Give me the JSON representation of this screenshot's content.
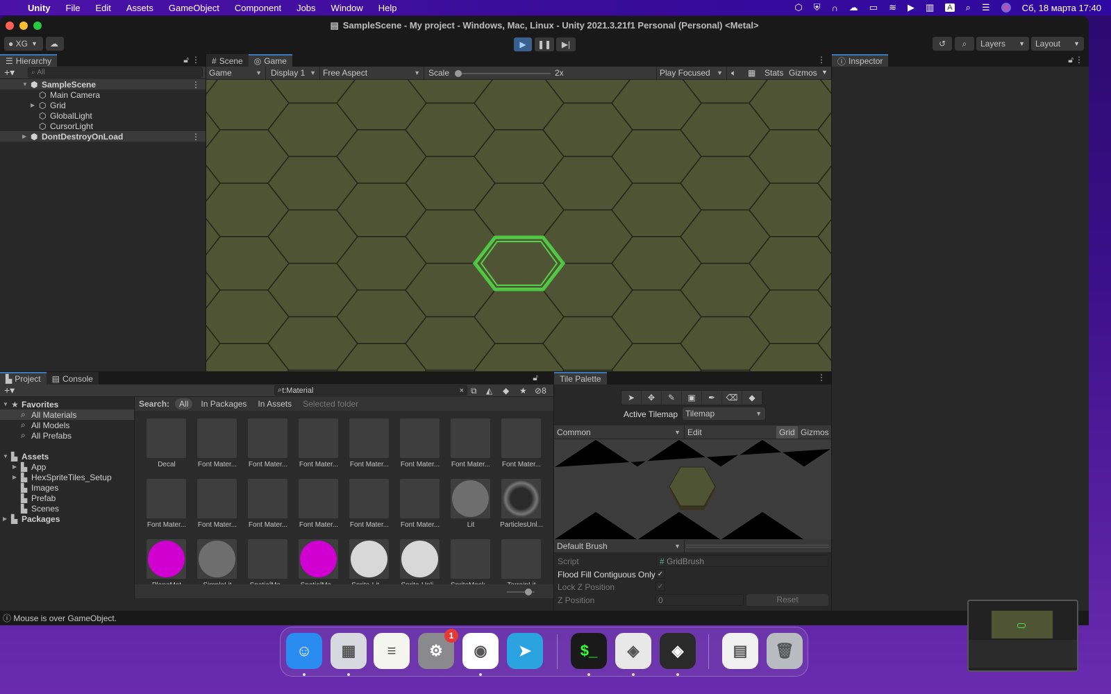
{
  "menubar": {
    "apple": "",
    "app": "Unity",
    "items": [
      "File",
      "Edit",
      "Assets",
      "GameObject",
      "Component",
      "Jobs",
      "Window",
      "Help"
    ],
    "status_icons": [
      "unity-icon",
      "vpn-icon",
      "headphones-icon",
      "cloud-icon",
      "battery-icon",
      "wifi-icon",
      "play-icon",
      "keyboard-icon",
      "input-source-icon",
      "search-icon",
      "control-center-icon",
      "siri-icon"
    ],
    "input_source": "A",
    "datetime": "Сб, 18 марта  17:40"
  },
  "window": {
    "title": "SampleScene - My project - Windows, Mac, Linux - Unity 2021.3.21f1 Personal (Personal) <Metal>"
  },
  "toolbar": {
    "account": "XG",
    "layers": "Layers",
    "layout": "Layout"
  },
  "hierarchy": {
    "tab": "Hierarchy",
    "search_placeholder": "All",
    "items": [
      {
        "label": "SampleScene",
        "level": 0,
        "type": "scene",
        "expanded": true,
        "selected": true
      },
      {
        "label": "Main Camera",
        "level": 1,
        "type": "object"
      },
      {
        "label": "Grid",
        "level": 1,
        "type": "object",
        "collapsed": true
      },
      {
        "label": "GlobalLight",
        "level": 1,
        "type": "object"
      },
      {
        "label": "CursorLight",
        "level": 1,
        "type": "object"
      },
      {
        "label": "DontDestroyOnLoad",
        "level": 0,
        "type": "scene",
        "collapsed": true,
        "selected": true
      }
    ]
  },
  "game": {
    "tabs": [
      "Scene",
      "Game"
    ],
    "active_tab": "Game",
    "view_mode": "Game",
    "display": "Display 1",
    "aspect": "Free Aspect",
    "scale_label": "Scale",
    "scale_value": "2x",
    "scale_fraction": 0,
    "play_mode": "Play Focused",
    "stats": "Stats",
    "gizmos": "Gizmos",
    "colors": {
      "tile": "#4f5434",
      "tile_line": "#24261a",
      "highlight": "#52e04a"
    }
  },
  "inspector": {
    "tab": "Inspector"
  },
  "project": {
    "tabs": [
      "Project",
      "Console"
    ],
    "search_value": "t:Material",
    "hidden_count": "8",
    "search_label": "Search:",
    "scopes": [
      "All",
      "In Packages",
      "In Assets",
      "Selected folder"
    ],
    "tree": [
      {
        "label": "Favorites",
        "level": 0,
        "icon": "star",
        "expanded": true
      },
      {
        "label": "All Materials",
        "level": 1,
        "icon": "search",
        "selected": true
      },
      {
        "label": "All Models",
        "level": 1,
        "icon": "search"
      },
      {
        "label": "All Prefabs",
        "level": 1,
        "icon": "search"
      },
      {
        "label": "",
        "level": 0,
        "icon": ""
      },
      {
        "label": "Assets",
        "level": 0,
        "icon": "folder",
        "expanded": true
      },
      {
        "label": "App",
        "level": 1,
        "icon": "folder",
        "collapsed": true
      },
      {
        "label": "HexSpriteTiles_Setup",
        "level": 1,
        "icon": "folder",
        "collapsed": true
      },
      {
        "label": "Images",
        "level": 1,
        "icon": "folder"
      },
      {
        "label": "Prefab",
        "level": 1,
        "icon": "folder"
      },
      {
        "label": "Scenes",
        "level": 1,
        "icon": "folder"
      },
      {
        "label": "Packages",
        "level": 0,
        "icon": "folder",
        "collapsed": true
      }
    ],
    "assets": [
      {
        "label": "Decal",
        "preview": "square"
      },
      {
        "label": "Font Mater...",
        "preview": "square"
      },
      {
        "label": "Font Mater...",
        "preview": "square"
      },
      {
        "label": "Font Mater...",
        "preview": "square"
      },
      {
        "label": "Font Mater...",
        "preview": "square"
      },
      {
        "label": "Font Mater...",
        "preview": "square"
      },
      {
        "label": "Font Mater...",
        "preview": "square"
      },
      {
        "label": "Font Mater...",
        "preview": "square"
      },
      {
        "label": "Font Mater...",
        "preview": "square"
      },
      {
        "label": "Font Mater...",
        "preview": "square"
      },
      {
        "label": "Font Mater...",
        "preview": "square"
      },
      {
        "label": "Font Mater...",
        "preview": "square"
      },
      {
        "label": "Font Mater...",
        "preview": "square"
      },
      {
        "label": "Font Mater...",
        "preview": "square"
      },
      {
        "label": "Lit",
        "preview": "circle",
        "color": "#6e6e6e"
      },
      {
        "label": "ParticlesUnl...",
        "preview": "sphere",
        "color": "#3a3a3a"
      },
      {
        "label": "PlaneMat",
        "preview": "circle",
        "color": "#d000d0"
      },
      {
        "label": "SimpleLit",
        "preview": "circle",
        "color": "#6e6e6e"
      },
      {
        "label": "SpatialMa...",
        "preview": "square"
      },
      {
        "label": "SpatialMa...",
        "preview": "circle",
        "color": "#d000d0"
      },
      {
        "label": "Sprite-Lit-...",
        "preview": "circle",
        "color": "#d8d8d8"
      },
      {
        "label": "Sprite-Unli...",
        "preview": "circle",
        "color": "#d8d8d8"
      },
      {
        "label": "SpriteMask...",
        "preview": "square"
      },
      {
        "label": "TerrainLit",
        "preview": "square"
      }
    ]
  },
  "tile_palette": {
    "tab": "Tile Palette",
    "tools": [
      "select-icon",
      "move-icon",
      "paint-brush-icon",
      "box-fill-icon",
      "picker-icon",
      "eraser-icon",
      "fill-icon"
    ],
    "active_tilemap_label": "Active Tilemap",
    "active_tilemap": "Tilemap",
    "palette": "Common",
    "edit": "Edit",
    "grid": "Grid",
    "gizmos": "Gizmos",
    "brush": "Default Brush",
    "props": {
      "script_label": "Script",
      "script_value": "GridBrush",
      "flood_label": "Flood Fill Contiguous Only",
      "flood_checked": true,
      "lockz_label": "Lock Z Position",
      "lockz_checked": true,
      "zpos_label": "Z Position",
      "zpos_value": "0",
      "reset": "Reset"
    }
  },
  "status": {
    "message": "Mouse is over GameObject."
  },
  "dock": {
    "apps": [
      {
        "name": "Finder",
        "color": "#2a8cf0",
        "glyph": "☺"
      },
      {
        "name": "Launchpad",
        "color": "#d8d8e0",
        "glyph": "▦"
      },
      {
        "name": "Notes",
        "color": "#f5f5f0",
        "glyph": "≡"
      },
      {
        "name": "System Settings",
        "color": "#8a8a8e",
        "glyph": "⚙",
        "badge": "1"
      },
      {
        "name": "Google Chrome",
        "color": "#ffffff",
        "glyph": "◉"
      },
      {
        "name": "Telegram",
        "color": "#2aa3e0",
        "glyph": "➤"
      },
      {
        "name": "Terminal",
        "color": "#1a1a1a",
        "glyph": "$_"
      },
      {
        "name": "Unity Hub",
        "color": "#e8e8e8",
        "glyph": "◈"
      },
      {
        "name": "Unity",
        "color": "#2a2a2a",
        "glyph": "◈"
      },
      {
        "name": "Preview",
        "color": "#f0f0f0",
        "glyph": "▤"
      },
      {
        "name": "Trash",
        "color": "#b8bcc0",
        "glyph": "🗑"
      }
    ]
  }
}
